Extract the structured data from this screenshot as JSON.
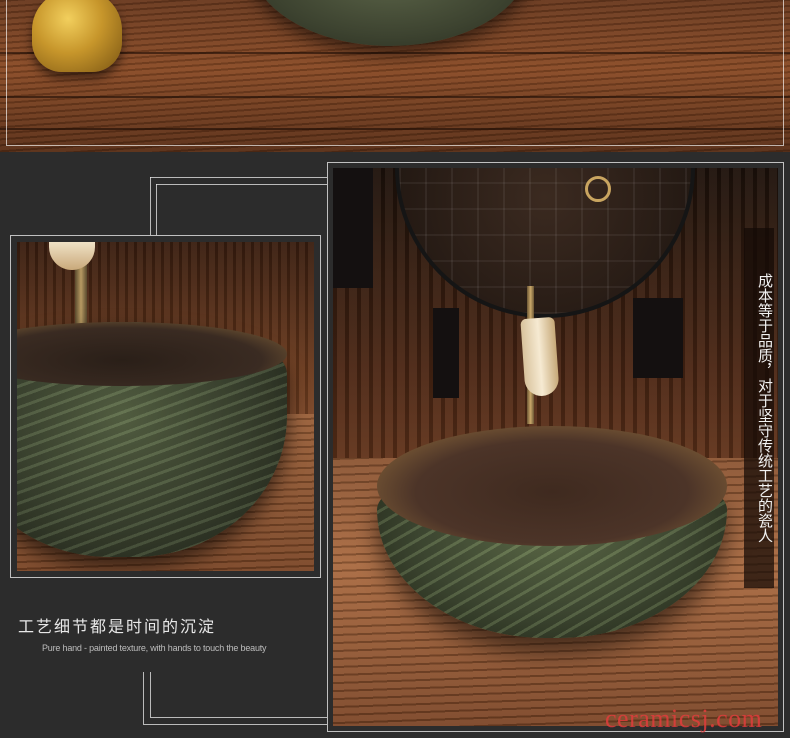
{
  "left_caption": {
    "title": "工艺细节都是时间的沉淀",
    "subtitle": "Pure hand - painted texture, with hands to touch the beauty"
  },
  "right_vertical_text": "成本等于品质，对于坚守传统工艺的瓷人",
  "watermark": "ceramicsj.com",
  "colors": {
    "background": "#2c2c2c",
    "frame_line": "#e6e6e6",
    "watermark": "#e13c3c"
  }
}
